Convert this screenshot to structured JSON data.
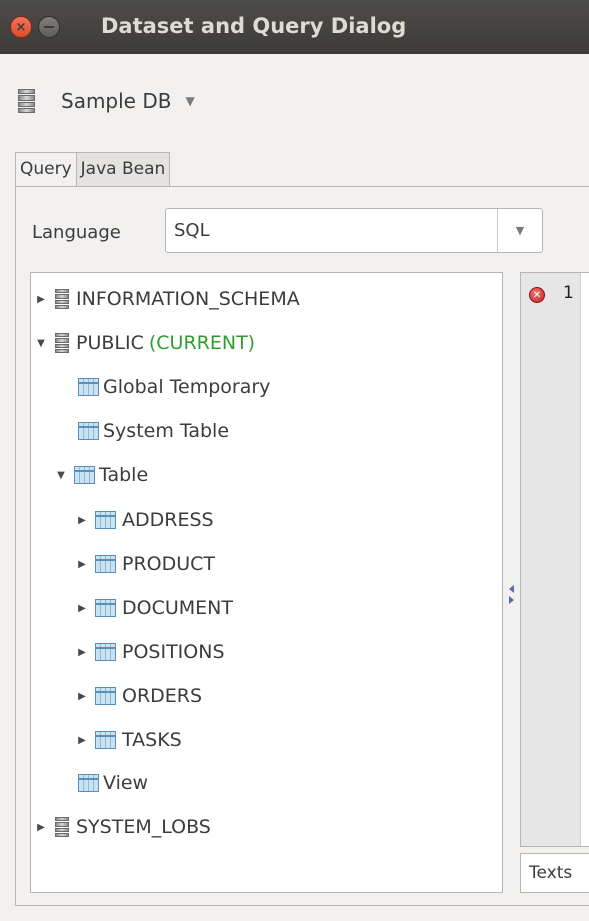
{
  "window": {
    "title": "Dataset and Query Dialog"
  },
  "datasource": {
    "label": "Sample DB"
  },
  "tabs": [
    {
      "label": "Query",
      "active": true
    },
    {
      "label": "Java Bean",
      "active": false
    }
  ],
  "language": {
    "label": "Language",
    "value": "SQL"
  },
  "tree": {
    "schemas": [
      {
        "label": "INFORMATION_SCHEMA",
        "expanded": false
      },
      {
        "label": "PUBLIC",
        "suffix": "(CURRENT)",
        "expanded": true
      },
      {
        "label": "SYSTEM_LOBS",
        "expanded": false
      }
    ],
    "categories": {
      "global_temporary": "Global Temporary",
      "system_table": "System Table",
      "table": "Table",
      "view": "View"
    },
    "tables": [
      "ADDRESS",
      "PRODUCT",
      "DOCUMENT",
      "POSITIONS",
      "ORDERS",
      "TASKS"
    ]
  },
  "editor": {
    "line_number": "1",
    "bottom_tab": "Texts"
  },
  "colors": {
    "current_schema": "#2e9e2e",
    "error": "#c81e1e",
    "titlebar": "#3c3b37"
  },
  "icons": [
    "close-icon",
    "minimize-icon",
    "database-icon",
    "table-icon",
    "chevron-down-icon",
    "expander-icon",
    "error-icon"
  ]
}
